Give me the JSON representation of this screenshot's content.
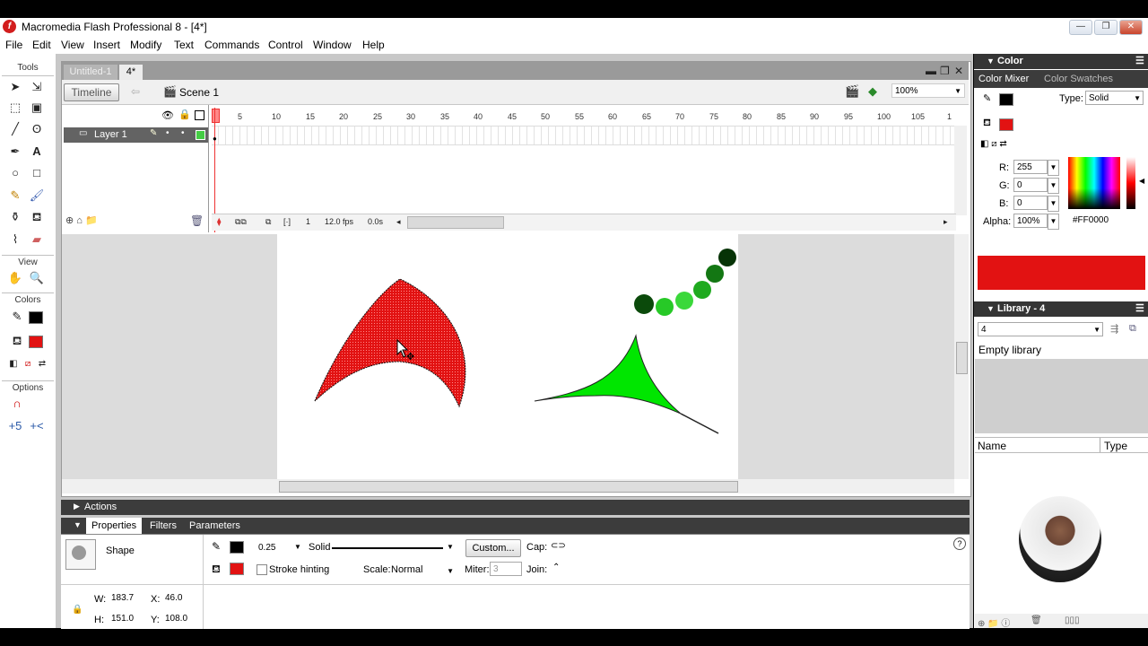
{
  "window": {
    "title": "Macromedia Flash Professional 8 - [4*]"
  },
  "menu": [
    "File",
    "Edit",
    "View",
    "Insert",
    "Modify",
    "Text",
    "Commands",
    "Control",
    "Window",
    "Help"
  ],
  "tools_panel": {
    "title": "Tools",
    "view_label": "View",
    "colors_label": "Colors",
    "options_label": "Options"
  },
  "document": {
    "tabs": [
      "Untitled-1",
      "4*"
    ],
    "timeline_button": "Timeline",
    "scene": "Scene 1",
    "zoom": "100%",
    "layer_name": "Layer 1",
    "ruler_ticks": [
      "5",
      "10",
      "15",
      "20",
      "25",
      "30",
      "35",
      "40",
      "45",
      "50",
      "55",
      "60",
      "65",
      "70",
      "75",
      "80",
      "85",
      "90",
      "95",
      "100",
      "105",
      "1"
    ],
    "frame": "1",
    "fps": "12.0 fps",
    "time": "0.0s"
  },
  "actions_label": "Actions",
  "properties": {
    "tabs": [
      "Properties",
      "Filters",
      "Parameters"
    ],
    "kind": "Shape",
    "stroke_height": "0.25",
    "stroke_style": "Solid",
    "custom_button": "Custom...",
    "cap_label": "Cap:",
    "stroke_hinting": "Stroke hinting",
    "scale_label": "Scale:",
    "scale_value": "Normal",
    "miter_label": "Miter:",
    "miter_value": "3",
    "join_label": "Join:",
    "w_label": "W:",
    "w": "183.7",
    "h_label": "H:",
    "h": "151.0",
    "x_label": "X:",
    "x": "46.0",
    "y_label": "Y:",
    "y": "108.0"
  },
  "color_panel": {
    "title": "Color",
    "tabs": [
      "Color Mixer",
      "Color Swatches"
    ],
    "type_label": "Type:",
    "type_value": "Solid",
    "r_label": "R:",
    "r": "255",
    "g_label": "G:",
    "g": "0",
    "b_label": "B:",
    "b": "0",
    "alpha_label": "Alpha:",
    "alpha": "100%",
    "hex": "#FF0000"
  },
  "library_panel": {
    "title": "Library - 4",
    "select": "4",
    "empty_text": "Empty library",
    "col_name": "Name",
    "col_type": "Type"
  },
  "colors": {
    "fill": "#e21212",
    "stroke": "#000000",
    "green": "#00e600",
    "accent": "#d21d1d"
  }
}
